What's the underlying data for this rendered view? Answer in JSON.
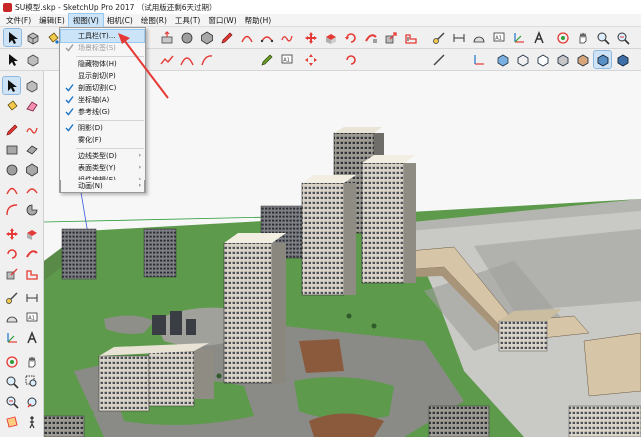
{
  "window": {
    "title": "SU模型.skp - SketchUp Pro 2017  （试用版还剩6天过期）"
  },
  "menubar": {
    "items": [
      {
        "label": "文件(F)"
      },
      {
        "label": "编辑(E)"
      },
      {
        "label": "视图(V)"
      },
      {
        "label": "相机(C)"
      },
      {
        "label": "绘图(R)"
      },
      {
        "label": "工具(T)"
      },
      {
        "label": "窗口(W)"
      },
      {
        "label": "帮助(H)"
      }
    ],
    "active_index": 2
  },
  "view_menu": {
    "items": [
      {
        "label": "工具栏(T)...",
        "highlighted": true
      },
      {
        "label": "场景标签(S)",
        "disabled": true,
        "checked": true
      },
      {
        "label": "隐藏物体(H)"
      },
      {
        "label": "显示剖切(P)"
      },
      {
        "label": "剖面切割(C)",
        "checked": true
      },
      {
        "label": "坐标轴(A)",
        "checked": true
      },
      {
        "label": "参考线(G)",
        "checked": true
      },
      {
        "label": "阴影(D)",
        "checked": true
      },
      {
        "label": "雾化(F)"
      },
      {
        "label": "边线类型(D)",
        "submenu": true
      },
      {
        "label": "表面类型(Y)",
        "submenu": true
      },
      {
        "label": "组件编辑(E)",
        "submenu": true
      },
      {
        "label": "动画(N)",
        "submenu": true
      }
    ]
  },
  "colors": {
    "accent_red": "#e53935",
    "check_blue": "#1e74c8",
    "grass_green": "#5e9a4c",
    "plaza_gray": "#8a8a86",
    "axis_green": "#2e9d3c",
    "axis_blue": "#3b5bdb"
  },
  "icons": {
    "select": "arrow-pointer-icon",
    "eraser": "eraser-icon",
    "pencil": "pencil-icon",
    "rectangle": "rectangle-icon",
    "circle": "circle-icon",
    "arc": "arc-icon",
    "move": "move-icon",
    "rotate": "rotate-icon",
    "scale": "scale-icon",
    "offset": "offset-icon",
    "tape": "tape-measure-icon",
    "text": "text-icon",
    "axes": "axes-icon",
    "orbit": "orbit-icon",
    "pan": "pan-icon",
    "zoom": "zoom-icon",
    "zoom_extents": "zoom-extents-icon",
    "walk": "walk-icon",
    "section": "section-plane-icon",
    "styles": "style-cube-icon",
    "paint": "paint-bucket-icon",
    "components": "component-icon"
  }
}
